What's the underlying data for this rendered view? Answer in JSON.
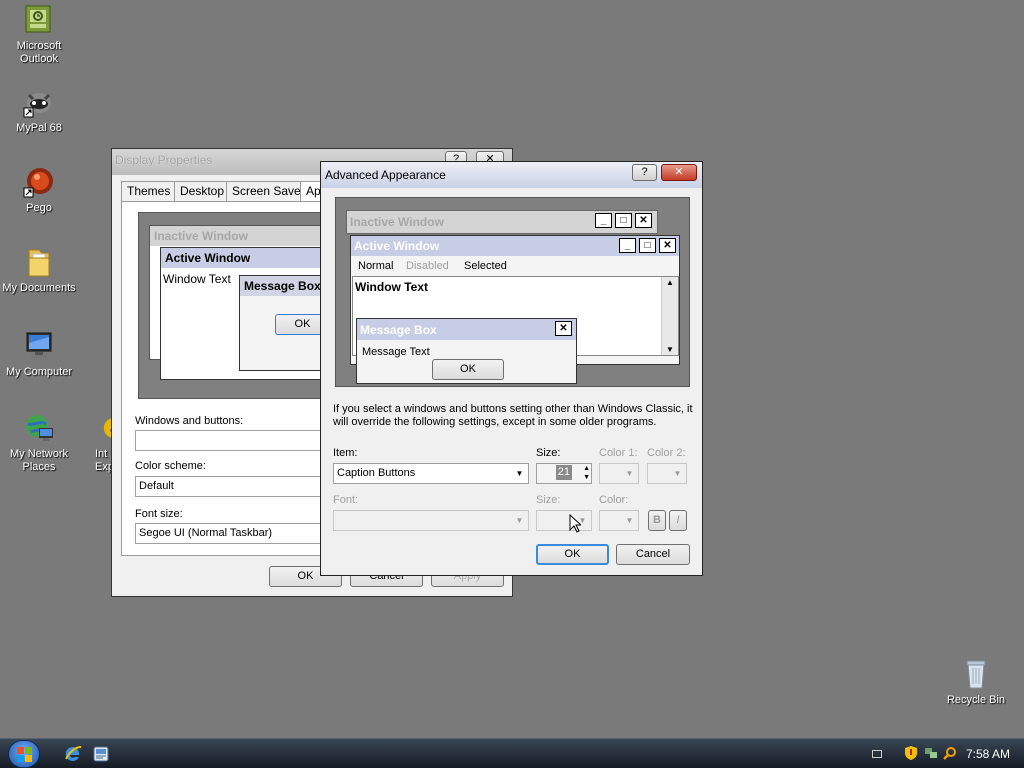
{
  "desktop": {
    "icons": [
      {
        "label": "Microsoft Outlook"
      },
      {
        "label": "MyPal 68"
      },
      {
        "label": "Pego"
      },
      {
        "label": "My Documents"
      },
      {
        "label": "My Computer"
      },
      {
        "label": "My Network Places"
      },
      {
        "label": "Int Exp"
      },
      {
        "label": "Recycle Bin"
      }
    ]
  },
  "display_properties": {
    "title": "Display Properties",
    "help": "?",
    "close": "✕",
    "tabs": [
      "Themes",
      "Desktop",
      "Screen Saver",
      "Ap"
    ],
    "preview": {
      "inactive": "Inactive Window",
      "active": "Active Window",
      "window_text": "Window Text",
      "message_box": "Message Box",
      "ok": "OK"
    },
    "windows_and_buttons_label": "Windows and buttons:",
    "windows_and_buttons_value": "",
    "color_scheme_label": "Color scheme:",
    "color_scheme_value": "Default",
    "font_size_label": "Font size:",
    "font_size_value": "Segoe UI (Normal Taskbar)",
    "ok": "OK",
    "cancel": "Cancel",
    "apply": "Apply"
  },
  "advanced": {
    "title": "Advanced Appearance",
    "help": "?",
    "close": "✕",
    "preview": {
      "inactive": "Inactive Window",
      "active": "Active Window",
      "menu_normal": "Normal",
      "menu_disabled": "Disabled",
      "menu_selected": "Selected",
      "window_text": "Window Text",
      "message_box": "Message Box",
      "message_text": "Message Text",
      "ok": "OK"
    },
    "info": "If you select a windows and buttons setting other than Windows Classic, it will override the following settings, except in some older programs.",
    "item_label": "Item:",
    "item_value": "Caption Buttons",
    "size_label": "Size:",
    "size_value": "21",
    "color1_label": "Color 1:",
    "color2_label": "Color 2:",
    "font_label": "Font:",
    "font_size_label": "Size:",
    "font_color_label": "Color:",
    "bold": "B",
    "italic": "I",
    "ok": "OK",
    "cancel": "Cancel"
  },
  "taskbar": {
    "clock": "7:58 AM"
  },
  "colors": {
    "desktop": "#7a7a7a",
    "active_caption": "#c7cde4",
    "inactive_caption_text": "#a7a7a7",
    "preview_bg": "#808080"
  }
}
